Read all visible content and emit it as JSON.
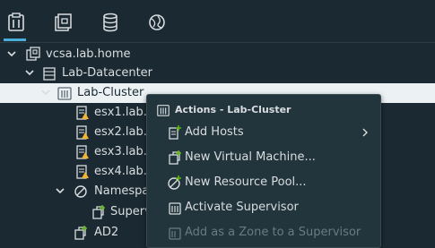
{
  "toolbar": {
    "tabs": [
      {
        "icon": "hosts-clusters-icon",
        "active": true
      },
      {
        "icon": "vms-templates-icon",
        "active": false
      },
      {
        "icon": "storage-icon",
        "active": false
      },
      {
        "icon": "networking-icon",
        "active": false
      }
    ]
  },
  "tree": {
    "nodes": [
      {
        "label": "vcsa.lab.home",
        "icon": "vcenter-icon",
        "expanded": true
      },
      {
        "label": "Lab-Datacenter",
        "icon": "datacenter-icon",
        "expanded": true
      },
      {
        "label": "Lab-Cluster",
        "icon": "cluster-icon",
        "expanded": true,
        "selected": true
      },
      {
        "label": "esx1.lab.h",
        "icon": "host-warning-icon"
      },
      {
        "label": "esx2.lab.h",
        "icon": "host-warning-icon"
      },
      {
        "label": "esx3.lab.h",
        "icon": "host-warning-icon"
      },
      {
        "label": "esx4.lab.h",
        "icon": "host-warning-icon"
      },
      {
        "label": "Namespa",
        "icon": "namespace-icon",
        "expanded": true
      },
      {
        "label": "Superv",
        "icon": "supervisor-vm-icon"
      },
      {
        "label": "AD2",
        "icon": "vm-icon"
      }
    ]
  },
  "context_menu": {
    "header": "Actions - Lab-Cluster",
    "items": [
      {
        "label": "Add Hosts",
        "icon": "add-hosts-icon",
        "submenu": true,
        "enabled": true
      },
      {
        "label": "New Virtual Machine...",
        "icon": "new-vm-icon",
        "enabled": true
      },
      {
        "label": "New Resource Pool...",
        "icon": "new-resource-pool-icon",
        "enabled": true
      },
      {
        "label": "Activate Supervisor",
        "icon": "activate-supervisor-icon",
        "enabled": true
      },
      {
        "label": "Add as a Zone to a Supervisor",
        "icon": "zone-icon",
        "enabled": false
      }
    ]
  },
  "colors": {
    "background": "#1b2a32",
    "accent": "#49afd9",
    "selected_row": "#ecf1f4",
    "warning": "#f5b335",
    "success": "#60b515"
  }
}
